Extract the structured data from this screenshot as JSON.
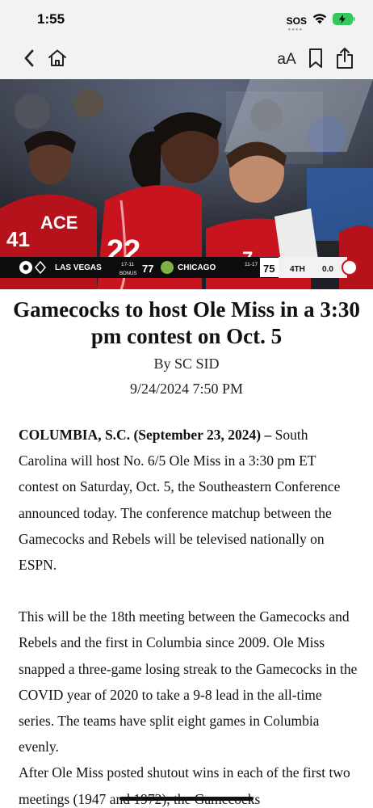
{
  "status": {
    "time": "1:55",
    "sos": "SOS",
    "wifi_icon": "wifi-icon",
    "battery_icon": "battery-charging-icon",
    "battery_color": "#34c759"
  },
  "nav": {
    "back_icon": "chevron-left-icon",
    "home_icon": "home-icon",
    "text_size_label": "aA",
    "bookmark_icon": "bookmark-icon",
    "share_icon": "share-icon"
  },
  "hero": {
    "scoreboard": {
      "away_team": "LAS VEGAS",
      "away_record": "17-11",
      "away_bonus": "BONUS",
      "away_score": "77",
      "home_team": "CHICAGO",
      "home_record": "11-17",
      "home_score": "75",
      "period": "4TH",
      "clock": "0.0"
    },
    "jersey_text": "ACE",
    "jersey_number_left": "41",
    "jersey_number_mid": "22",
    "jersey_number_right": "7"
  },
  "article": {
    "title": "Gamecocks to host Ole Miss in a 3:30 pm contest on Oct. 5",
    "byline": "By SC SID",
    "date": "9/24/2024 7:50 PM",
    "dateline": "COLUMBIA, S.C. (September 23, 2024) –",
    "paragraph1": " South Carolina will host No. 6/5 Ole Miss in a 3:30 pm ET contest on Saturday, Oct. 5, the Southeastern Conference announced today. The conference matchup between the Gamecocks and Rebels will be televised nationally on ESPN.",
    "paragraph2": "This will be the 18th meeting between the Gamecocks and Rebels and the first in Columbia since 2009. Ole Miss snapped a three-game losing streak to the Gamecocks in the COVID year of 2020 to take a 9-8 lead in the all-time series. The teams have split eight games in Columbia evenly.",
    "paragraph3": "After Ole Miss posted shutout wins in each of the first two meetings (1947 and 1972), the Gamecocks"
  }
}
